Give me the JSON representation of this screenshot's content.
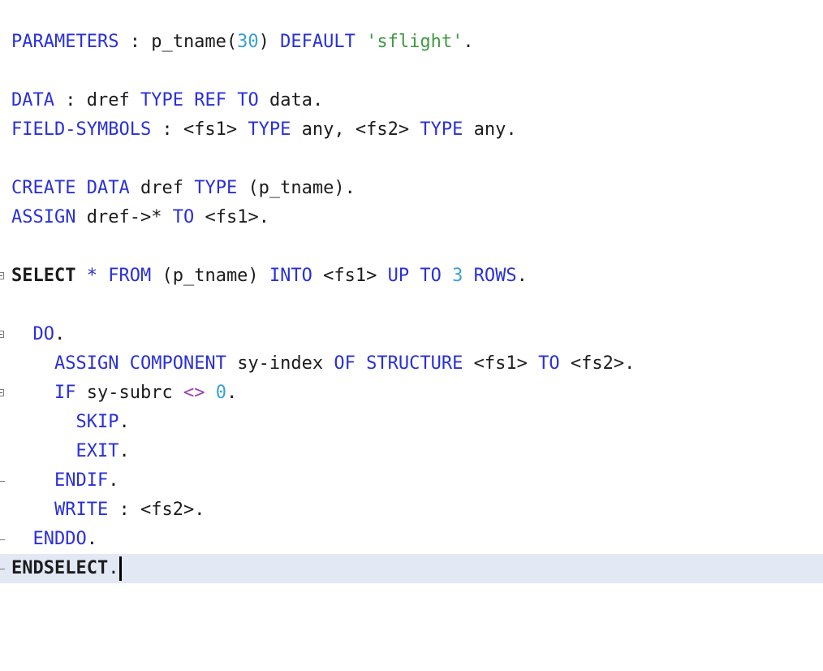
{
  "lines": [
    {
      "tokens": [
        "PARAMETERS",
        " : ",
        "p_tname",
        "(",
        "30",
        ")",
        " ",
        "DEFAULT",
        " ",
        "'sflight'",
        "."
      ]
    },
    {
      "tokens": [
        "DATA",
        " : ",
        "dref",
        " ",
        "TYPE",
        " ",
        "REF",
        " ",
        "TO",
        " ",
        "data",
        "."
      ]
    },
    {
      "tokens": [
        "FIELD-SYMBOLS",
        " : ",
        "<fs1>",
        " ",
        "TYPE",
        " ",
        "any",
        ", ",
        "<fs2>",
        " ",
        "TYPE",
        " ",
        "any",
        "."
      ]
    },
    {
      "tokens": [
        "CREATE",
        " ",
        "DATA",
        " ",
        "dref",
        " ",
        "TYPE",
        " ",
        "(p_tname)",
        "."
      ]
    },
    {
      "tokens": [
        "ASSIGN",
        " ",
        "dref->",
        "*",
        " ",
        "TO",
        " ",
        "<fs1>",
        "."
      ]
    },
    {
      "tokens": [
        "SELECT",
        " ",
        "*",
        " ",
        "FROM",
        " ",
        "(p_tname)",
        " ",
        "INTO",
        " ",
        "<fs1>",
        " ",
        "UP",
        " ",
        "TO",
        " ",
        "3",
        " ",
        "ROWS",
        "."
      ]
    },
    {
      "tokens": [
        "  ",
        "DO",
        "."
      ]
    },
    {
      "tokens": [
        "    ",
        "ASSIGN",
        " ",
        "COMPONENT",
        " ",
        "sy-index",
        " ",
        "OF",
        " ",
        "STRUCTURE",
        " ",
        "<fs1>",
        " ",
        "TO",
        " ",
        "<fs2>",
        "."
      ]
    },
    {
      "tokens": [
        "    ",
        "IF",
        " ",
        "sy-subrc",
        " ",
        "<>",
        " ",
        "0",
        "."
      ]
    },
    {
      "tokens": [
        "      ",
        "SKIP",
        "."
      ]
    },
    {
      "tokens": [
        "      ",
        "EXIT",
        "."
      ]
    },
    {
      "tokens": [
        "    ",
        "ENDIF",
        "."
      ]
    },
    {
      "tokens": [
        "    ",
        "WRITE",
        " : ",
        "<fs2>",
        "."
      ]
    },
    {
      "tokens": [
        "  ",
        "ENDDO",
        "."
      ]
    },
    {
      "tokens": [
        "ENDSELECT",
        "."
      ]
    }
  ],
  "colors": {
    "keyword": "#2a30d8",
    "identifier": "#1c1c1c",
    "number": "#3aa0d6",
    "string": "#3f9a3f",
    "operator": "#9a3fb0",
    "current_line_highlight": "#e3e8f5"
  }
}
